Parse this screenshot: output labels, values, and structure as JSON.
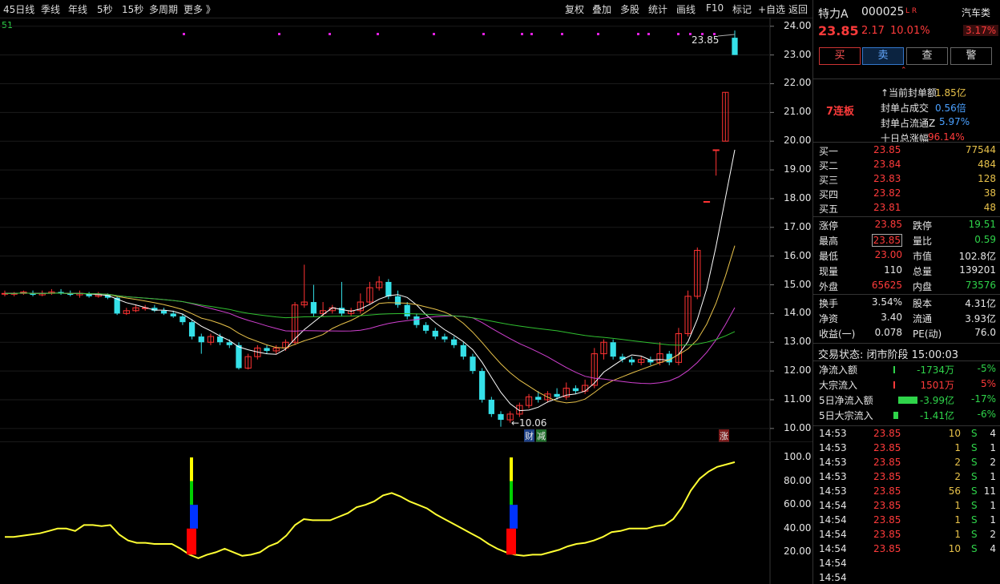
{
  "toolbar": {
    "left": [
      "45日线",
      "季线",
      "年线",
      "5秒",
      "15秒",
      "多周期",
      "更多 》"
    ],
    "right": [
      "复权",
      "叠加",
      "多股",
      "统计",
      "画线",
      "F10",
      "标记",
      "+自选",
      "返回"
    ]
  },
  "chart": {
    "corner_label": "51",
    "price_ticks": [
      "24.00",
      "23.00",
      "22.00",
      "21.00",
      "20.00",
      "19.00",
      "18.00",
      "17.00",
      "16.00",
      "15.00",
      "14.00",
      "13.00",
      "12.00",
      "11.00",
      "10.00"
    ],
    "high_mark": "23.85",
    "low_mark": "←10.06",
    "events": {
      "cai": "财",
      "jian": "减",
      "zhang": "涨"
    },
    "ind_ticks": [
      "100.0",
      "80.00",
      "60.00",
      "40.00",
      "20.00"
    ],
    "colors": {
      "up": "#ff3333",
      "down": "#35e0e8",
      "ma5": "#ffffff",
      "ma10": "#e8c24a",
      "ma20": "#d040d0",
      "ma60": "#30c030",
      "indicator": "#ffff33"
    }
  },
  "chart_data": {
    "type": "candlestick",
    "ylim": [
      9.8,
      24.3
    ],
    "candles": [
      [
        14.7,
        14.7,
        14.8,
        14.6
      ],
      [
        14.7,
        14.7,
        14.75,
        14.6
      ],
      [
        14.7,
        14.75,
        14.8,
        14.65
      ],
      [
        14.7,
        14.65,
        14.8,
        14.6
      ],
      [
        14.65,
        14.7,
        14.8,
        14.6
      ],
      [
        14.7,
        14.75,
        14.85,
        14.65
      ],
      [
        14.75,
        14.7,
        14.85,
        14.65
      ],
      [
        14.7,
        14.65,
        14.8,
        14.6
      ],
      [
        14.65,
        14.7,
        14.8,
        14.55
      ],
      [
        14.7,
        14.6,
        14.75,
        14.55
      ],
      [
        14.6,
        14.65,
        14.75,
        14.55
      ],
      [
        14.65,
        14.55,
        14.7,
        14.5
      ],
      [
        14.55,
        14.0,
        14.6,
        13.95
      ],
      [
        14.0,
        14.1,
        14.2,
        13.95
      ],
      [
        14.1,
        14.2,
        14.3,
        14.05
      ],
      [
        14.2,
        14.2,
        14.3,
        14.1
      ],
      [
        14.2,
        14.1,
        14.3,
        14.05
      ],
      [
        14.1,
        14.0,
        14.2,
        13.95
      ],
      [
        14.0,
        13.9,
        14.1,
        13.85
      ],
      [
        13.9,
        13.7,
        14.0,
        13.6
      ],
      [
        13.7,
        13.2,
        13.8,
        13.1
      ],
      [
        13.2,
        13.0,
        13.3,
        12.6
      ],
      [
        13.0,
        13.2,
        13.3,
        12.9
      ],
      [
        13.2,
        13.0,
        13.3,
        12.9
      ],
      [
        13.0,
        12.9,
        13.1,
        12.8
      ],
      [
        12.9,
        12.1,
        13.0,
        12.05
      ],
      [
        12.1,
        12.5,
        12.6,
        12.05
      ],
      [
        12.5,
        12.8,
        12.9,
        12.4
      ],
      [
        12.8,
        12.7,
        12.9,
        12.6
      ],
      [
        12.7,
        12.8,
        12.9,
        12.6
      ],
      [
        12.8,
        13.0,
        13.1,
        12.7
      ],
      [
        13.0,
        14.3,
        14.4,
        12.9
      ],
      [
        14.3,
        14.4,
        15.7,
        14.2
      ],
      [
        14.4,
        14.0,
        15.0,
        13.9
      ],
      [
        14.0,
        14.1,
        14.4,
        13.9
      ],
      [
        14.1,
        14.2,
        14.3,
        14.0
      ],
      [
        14.2,
        14.0,
        15.1,
        13.9
      ],
      [
        14.0,
        14.1,
        14.2,
        13.9
      ],
      [
        14.1,
        14.4,
        14.7,
        14.0
      ],
      [
        14.4,
        14.9,
        15.1,
        14.3
      ],
      [
        14.9,
        15.1,
        15.3,
        14.8
      ],
      [
        15.1,
        14.6,
        15.2,
        14.5
      ],
      [
        14.6,
        14.3,
        14.8,
        14.2
      ],
      [
        14.3,
        13.9,
        14.4,
        13.8
      ],
      [
        13.9,
        13.6,
        14.0,
        13.5
      ],
      [
        13.6,
        13.4,
        13.7,
        13.3
      ],
      [
        13.4,
        13.2,
        13.5,
        13.1
      ],
      [
        13.2,
        13.1,
        13.3,
        13.0
      ],
      [
        13.1,
        12.9,
        13.2,
        12.8
      ],
      [
        12.9,
        12.5,
        13.0,
        12.4
      ],
      [
        12.5,
        12.0,
        12.6,
        11.9
      ],
      [
        12.0,
        11.0,
        12.1,
        10.9
      ],
      [
        11.0,
        10.5,
        11.1,
        10.4
      ],
      [
        10.5,
        10.3,
        10.6,
        10.06
      ],
      [
        10.3,
        10.5,
        10.6,
        10.2
      ],
      [
        10.5,
        10.8,
        10.9,
        10.4
      ],
      [
        10.8,
        11.1,
        11.2,
        10.7
      ],
      [
        11.1,
        11.0,
        11.3,
        10.9
      ],
      [
        11.0,
        11.2,
        11.3,
        10.9
      ],
      [
        11.2,
        11.1,
        11.4,
        11.0
      ],
      [
        11.1,
        11.4,
        11.6,
        11.0
      ],
      [
        11.4,
        11.3,
        11.5,
        11.2
      ],
      [
        11.3,
        11.5,
        11.7,
        11.2
      ],
      [
        11.5,
        12.6,
        12.8,
        11.4
      ],
      [
        12.6,
        13.0,
        13.1,
        12.4
      ],
      [
        13.0,
        12.5,
        13.1,
        12.4
      ],
      [
        12.5,
        12.4,
        12.6,
        12.3
      ],
      [
        12.4,
        12.3,
        12.5,
        12.2
      ],
      [
        12.3,
        12.4,
        12.5,
        12.2
      ],
      [
        12.4,
        12.3,
        12.5,
        12.2
      ],
      [
        12.3,
        12.6,
        13.0,
        12.2
      ],
      [
        12.6,
        12.3,
        12.7,
        12.2
      ],
      [
        12.3,
        13.3,
        13.5,
        12.2
      ],
      [
        13.3,
        14.6,
        14.8,
        13.2
      ],
      [
        14.6,
        16.2,
        16.3,
        14.5
      ],
      [
        17.9,
        17.9,
        17.9,
        17.9
      ],
      [
        19.7,
        19.7,
        19.7,
        18.8
      ],
      [
        20.0,
        21.7,
        21.7,
        20.0
      ],
      [
        23.6,
        23.0,
        23.85,
        23.0
      ]
    ]
  },
  "stock": {
    "name": "特力A",
    "code": "000025",
    "tags": "L R",
    "sector": "汽车类",
    "sector_pct": "3.17%",
    "price": "23.85",
    "change": "2.17",
    "pct": "10.01%"
  },
  "buttons": [
    "买",
    "卖",
    "查",
    "警"
  ],
  "limit": {
    "boards": "7连板",
    "labels": [
      "↑当前封单额",
      "封单占成交",
      "封单占流通Z",
      "十日总涨幅"
    ],
    "values": [
      "1.85亿",
      "0.56倍",
      "5.97%",
      "96.14%"
    ]
  },
  "bids": [
    [
      "买一",
      "23.85",
      "77544"
    ],
    [
      "买二",
      "23.84",
      "484"
    ],
    [
      "买三",
      "23.83",
      "128"
    ],
    [
      "买四",
      "23.82",
      "38"
    ],
    [
      "买五",
      "23.81",
      "48"
    ]
  ],
  "quote": [
    [
      "涨停",
      "23.85",
      "跌停",
      "19.51"
    ],
    [
      "最高",
      "23.85",
      "量比",
      "0.59"
    ],
    [
      "最低",
      "23.00",
      "市值",
      "102.8亿"
    ],
    [
      "现量",
      "110",
      "总量",
      "139201"
    ],
    [
      "外盘",
      "65625",
      "内盘",
      "73576"
    ]
  ],
  "fund": [
    [
      "换手",
      "3.54%",
      "股本",
      "4.31亿"
    ],
    [
      "净资",
      "3.40",
      "流通",
      "3.93亿"
    ],
    [
      "收益(一)",
      "0.078",
      "PE(动)",
      "76.0"
    ]
  ],
  "status": "交易状态: 闭市阶段 15:00:03",
  "flows": [
    [
      "净流入额",
      "-1734万",
      "-5%"
    ],
    [
      "大宗流入",
      "1501万",
      "5%"
    ],
    [
      "5日净流入额",
      "-3.99亿",
      "-17%"
    ],
    [
      "5日大宗流入",
      "-1.41亿",
      "-6%"
    ]
  ],
  "ticks": [
    [
      "14:53",
      "23.85",
      "10",
      "S",
      "4"
    ],
    [
      "14:53",
      "23.85",
      "1",
      "S",
      "1"
    ],
    [
      "14:53",
      "23.85",
      "2",
      "S",
      "2"
    ],
    [
      "14:53",
      "23.85",
      "2",
      "S",
      "1"
    ],
    [
      "14:53",
      "23.85",
      "56",
      "S",
      "11"
    ],
    [
      "14:54",
      "23.85",
      "1",
      "S",
      "1"
    ],
    [
      "14:54",
      "23.85",
      "1",
      "S",
      "1"
    ],
    [
      "14:54",
      "23.85",
      "1",
      "S",
      "2"
    ],
    [
      "14:54",
      "23.85",
      "10",
      "S",
      "4"
    ],
    [
      "14:54",
      ""
    ],
    [
      "14:54",
      ""
    ]
  ]
}
